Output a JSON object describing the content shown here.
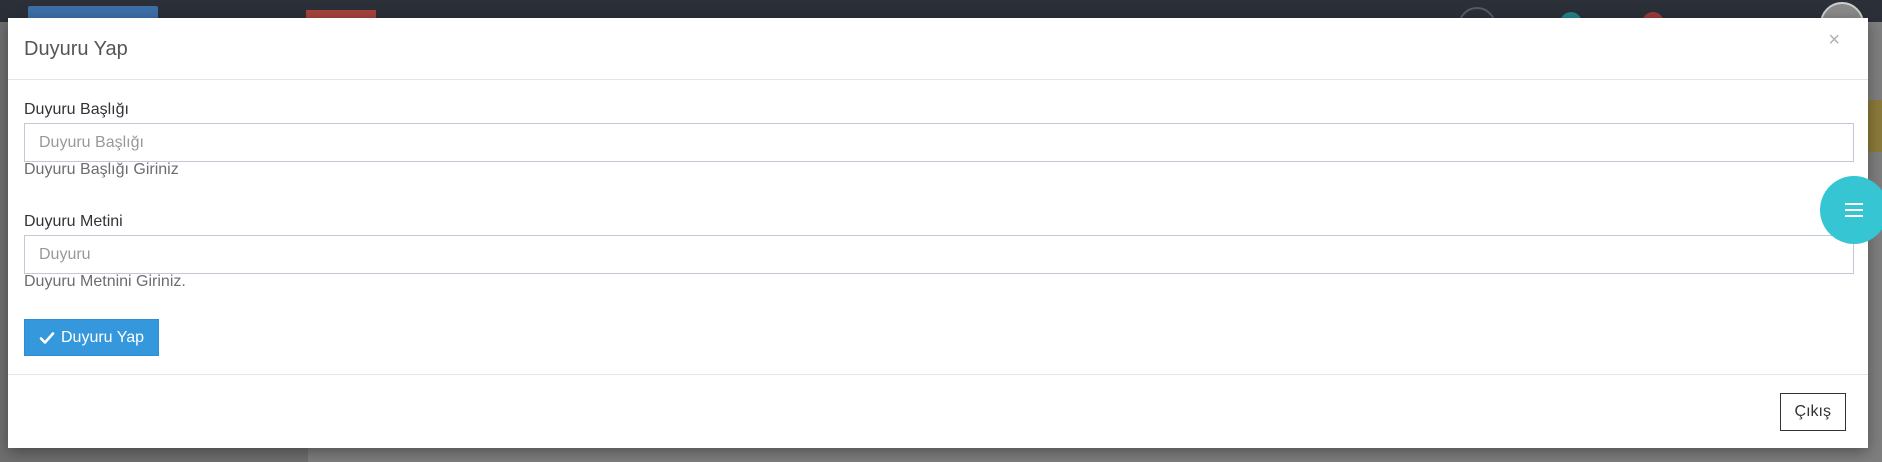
{
  "modal": {
    "title": "Duyuru Yap",
    "close_symbol": "×",
    "fields": [
      {
        "label": "Duyuru Başlığı",
        "placeholder": "Duyuru Başlığı",
        "value": "",
        "help": "Duyuru Başlığı Giriniz"
      },
      {
        "label": "Duyuru Metini",
        "placeholder": "Duyuru",
        "value": "",
        "help": "Duyuru Metnini Giriniz."
      }
    ],
    "submit_label": "Duyuru Yap",
    "submit_icon": "check-icon",
    "exit_label": "Çıkış"
  },
  "floating_button": {
    "icon": "hamburger-menu-icon"
  },
  "colors": {
    "primary": "#3598dc",
    "fab": "#36c6d3",
    "topbar": "#2b3038"
  }
}
